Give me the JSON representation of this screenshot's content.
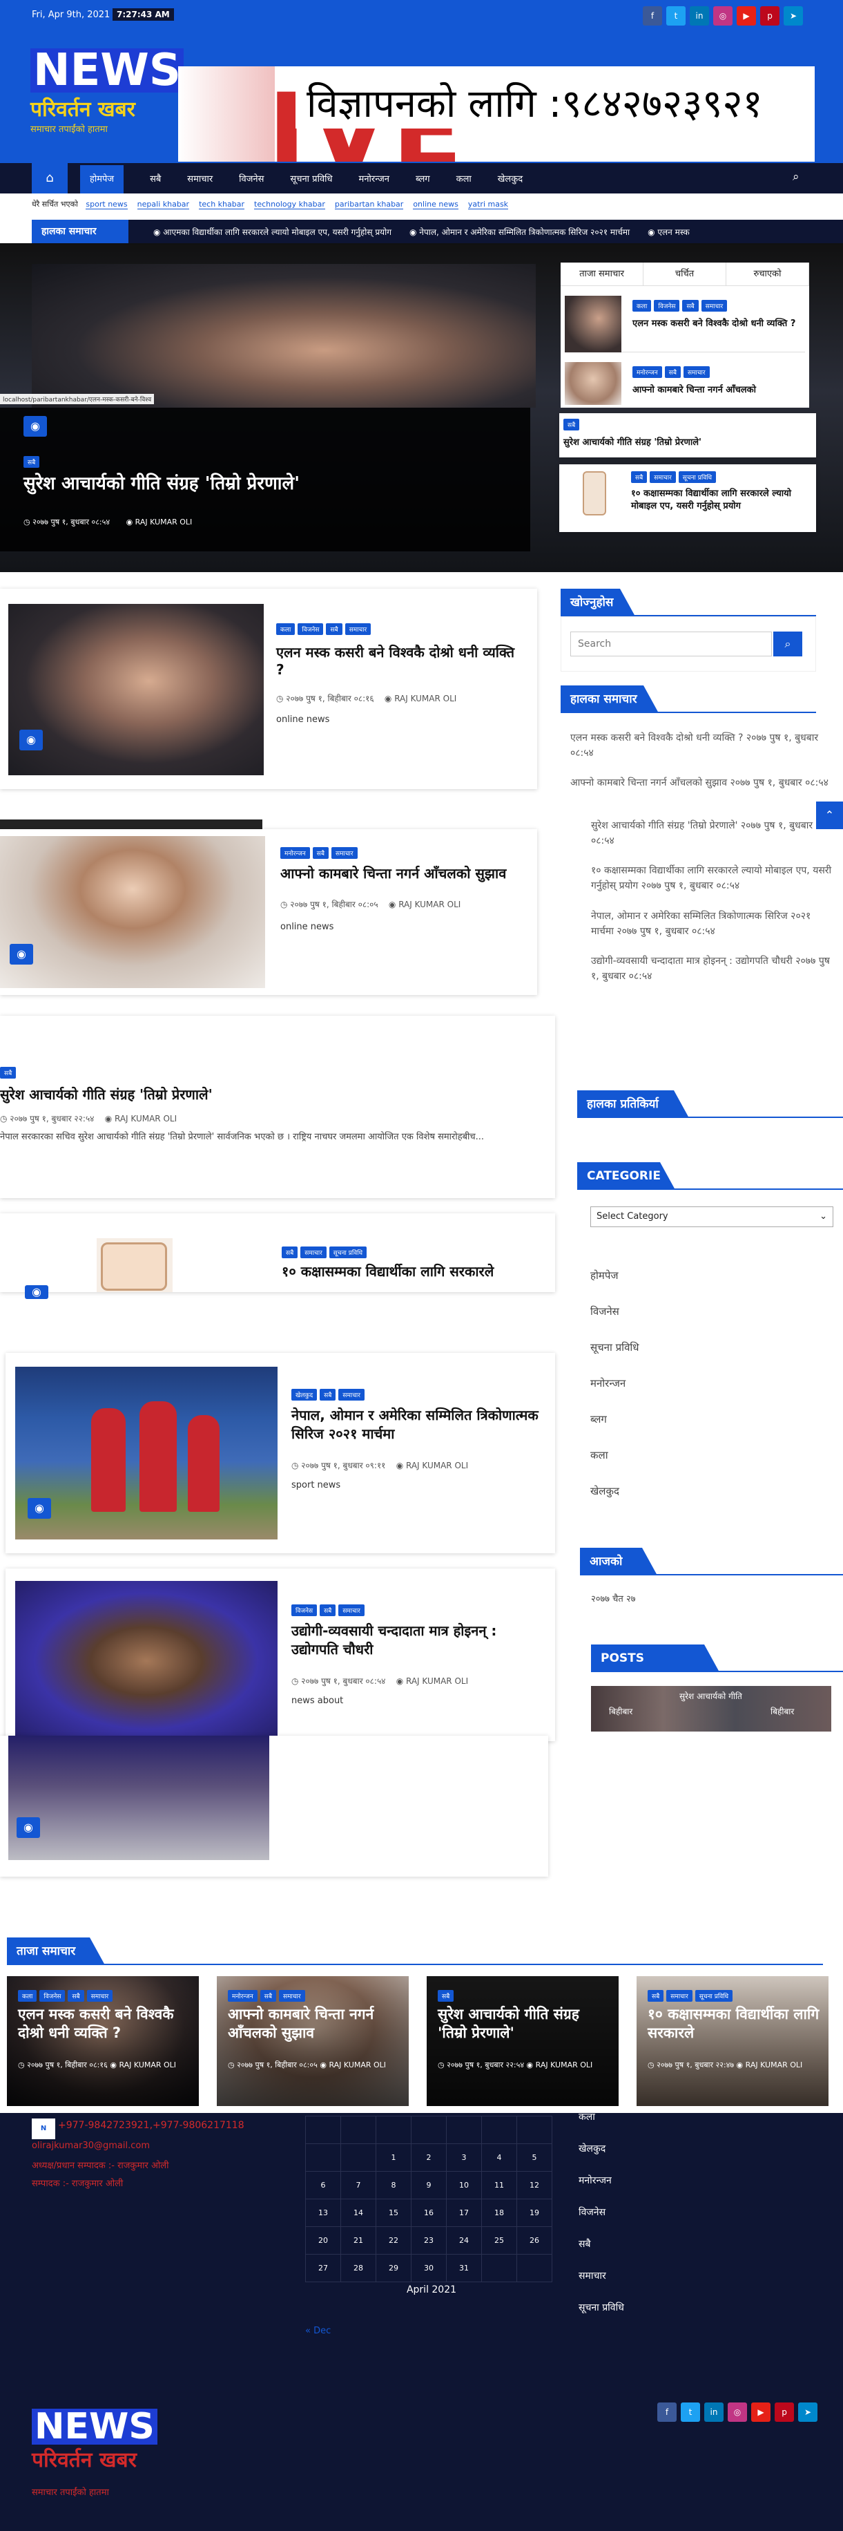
{
  "topbar": {
    "date": "Fri, Apr 9th, 2021",
    "time": "7:27:43 AM"
  },
  "logo": {
    "main": "NEWS",
    "sub": "परिवर्तन खबर",
    "tag": "समाचार तपाईंको हातमा"
  },
  "ad": {
    "text": "विज्ञापनको लागि :९८४२७२३९२१",
    "bg_text": "LIVE NEWS"
  },
  "nav": {
    "items": [
      "होमपेज",
      "सबै",
      "समाचार",
      "विजनेस",
      "सूचना प्रविधि",
      "मनोरन्जन",
      "ब्लग",
      "कला",
      "खेलकुद"
    ]
  },
  "tags": {
    "label": "धेरै सर्चित भएको",
    "items": [
      "sport news",
      "nepali khabar",
      "tech khabar",
      "technology khabar",
      "paribartan khabar",
      "online news",
      "yatri mask"
    ]
  },
  "ticker": {
    "label": "हालका समाचार",
    "items": [
      "आएमका विद्यार्थीका लागि सरकारले ल्यायो मोबाइल एप, यसरी गर्नुहोस् प्रयोग",
      "नेपाल, ओमान र अमेरिका सम्मिलित त्रिकोणात्मक सिरिज २०२१ मार्चमा",
      "एलन मस्क"
    ]
  },
  "hero": {
    "url": "localhost/paribartankhabar/एलन-मस्क-कसरी-बने-विश्व",
    "badge": "सबै",
    "title": "सुरेश आचार्यको गीति संग्रह 'तिम्रो प्रेरणाले'",
    "date": "२०७७ पुष १, बुधबार ०८:५४",
    "author": "RAJ KUMAR OLI"
  },
  "tabs": {
    "items": [
      "ताजा समाचार",
      "चर्चित",
      "रुचाएको"
    ]
  },
  "tabposts": [
    {
      "badges": [
        "कला",
        "विजनेस",
        "सबै",
        "समाचार"
      ],
      "title": "एलन मस्क कसरी बने विश्वकै दोश्रो धनी व्यक्ति ?"
    },
    {
      "badges": [
        "मनोरन्जन",
        "सबै",
        "समाचार"
      ],
      "title": "आफ्नो कामबारे चिन्ता नगर्न आँचलको"
    },
    {
      "badges": [
        "सबै"
      ],
      "title": "सुरेश आचार्यको गीति संग्रह 'तिम्रो प्रेरणाले'"
    },
    {
      "badges": [
        "सबै",
        "समाचार",
        "सूचना प्रविधि"
      ],
      "title": "१० कक्षासम्मका विद्यार्थीका लागि सरकारले ल्यायो मोबाइल एप, यसरी गर्नुहोस् प्रयोग"
    }
  ],
  "posts": [
    {
      "badges": [
        "कला",
        "विजनेस",
        "सबै",
        "समाचार"
      ],
      "title": "एलन मस्क कसरी बने विश्वकै दोश्रो धनी व्यक्ति ?",
      "date": "२०७७ पुष १, बिहीबार ०८:१६",
      "author": "RAJ KUMAR OLI",
      "tag": "online news"
    },
    {
      "badges": [
        "मनोरन्जन",
        "सबै",
        "समाचार"
      ],
      "title": "आफ्नो कामबारे चिन्ता नगर्न आँचलको सुझाव",
      "date": "२०७७ पुष १, बिहीबार ०८:०५",
      "author": "RAJ KUMAR OLI",
      "tag": "online news"
    },
    {
      "badges": [
        "सबै"
      ],
      "title": "सुरेश आचार्यको गीति संग्रह 'तिम्रो प्रेरणाले'",
      "date": "२०७७ पुष १, बुधबार २२:५४",
      "author": "RAJ KUMAR OLI",
      "excerpt": "नेपाल सरकारका सचिव सुरेश आचार्यको गीति संग्रह 'तिम्रो प्रेरणाले' सार्वजनिक भएको छ । राष्ट्रिय नाचघर जमलमा आयोजित एक विशेष समारोहबीच..."
    },
    {
      "badges": [
        "सबै",
        "समाचार",
        "सूचना प्रविधि"
      ],
      "title": "१० कक्षासम्मका विद्यार्थीका लागि सरकारले"
    },
    {
      "badges": [
        "खेलकुद",
        "सबै",
        "समाचार"
      ],
      "title": "नेपाल, ओमान र अमेरिका सम्मिलित त्रिकोणात्मक सिरिज २०२१ मार्चमा",
      "date": "२०७७ पुष १, बुधबार ०९:११",
      "author": "RAJ KUMAR OLI",
      "tag": "sport news"
    },
    {
      "badges": [
        "विजनेस",
        "सबै",
        "समाचार"
      ],
      "title": "उद्योगी-व्यवसायी चन्दादाता मात्र होइनन् : उद्योगपति चौधरी",
      "date": "२०७७ पुष १, बुधबार ०८:५४",
      "author": "RAJ KUMAR OLI",
      "tag": "news about"
    }
  ],
  "sidebar": {
    "search_title": "खोज्नुहोस",
    "search_placeholder": "Search",
    "recent_title": "हालका समाचार",
    "recent": [
      "एलन मस्क कसरी बने विश्वकै दोश्रो धनी व्यक्ति ? २०७७ पुष १, बुधबार ०८:५४",
      "आफ्नो कामबारे चिन्ता नगर्न आँचलको सुझाव २०७७ पुष १, बुधबार ०८:५४",
      "सुरेश आचार्यको गीति संग्रह 'तिम्रो प्रेरणाले' २०७७ पुष १, बुधबार ०८:५४",
      "१० कक्षासम्मका विद्यार्थीका लागि सरकारले ल्यायो मोबाइल एप, यसरी गर्नुहोस् प्रयोग २०७७ पुष १, बुधबार ०८:५४",
      "नेपाल, ओमान र अमेरिका सम्मिलित त्रिकोणात्मक सिरिज २०२१ मार्चमा २०७७ पुष १, बुधबार ०८:५४",
      "उद्योगी-व्यवसायी चन्दादाता मात्र होइनन् : उद्योगपति चौधरी २०७७ पुष १, बुधबार ०८:५४"
    ],
    "comments_title": "हालका प्रतिकिर्या",
    "categories_title": "CATEGORIES",
    "category_select": "Select Category",
    "categories": [
      "होमपेज",
      "विजनेस",
      "सूचना प्रविधि",
      "मनोरन्जन",
      "ब्लग",
      "कला",
      "खेलकुद"
    ],
    "date_title": "आजको तिथि",
    "date_value": "२०७७ चैत २७",
    "carousel_title": "POSTS CAROUSEL",
    "carousel_items": [
      "बिहीबार",
      "सुरेश आचार्यको गीति",
      "बिहीबार"
    ]
  },
  "trending": {
    "title": "ताजा समाचार",
    "items": [
      {
        "badges": [
          "कला",
          "विजनेस",
          "सबै",
          "समाचार"
        ],
        "title": "एलन मस्क कसरी बने विश्वकै दोश्रो धनी व्यक्ति ?",
        "date": "२०७७ पुष १, बिहीबार ०८:१६",
        "author": "RAJ KUMAR OLI"
      },
      {
        "badges": [
          "मनोरन्जन",
          "सबै",
          "समाचार"
        ],
        "title": "आफ्नो कामबारे चिन्ता नगर्न आँचलको सुझाव",
        "date": "२०७७ पुष १, बिहीबार ०८:०५",
        "author": "RAJ KUMAR OLI"
      },
      {
        "badges": [
          "सबै"
        ],
        "title": "सुरेश आचार्यको गीति संग्रह 'तिम्रो प्रेरणाले'",
        "date": "२०७७ पुष १, बुधबार २२:५४",
        "author": "RAJ KUMAR OLI"
      },
      {
        "badges": [
          "सबै",
          "समाचार",
          "सूचना प्रविधि"
        ],
        "title": "१० कक्षासम्मका विद्यार्थीका लागि सरकारले",
        "date": "२०७७ पुष १, बुधबार २२:४७",
        "author": "RAJ KUMAR OLI"
      }
    ]
  },
  "footer": {
    "phone": "+977-9842723921,+977-9806217118",
    "email": "olirajkumar30@gmail.com",
    "editor1": "अध्यक्ष/प्रधान सम्पादक :- राजकुमार ओली",
    "editor2": "सम्पादक :- राजकुमार ओली",
    "calendar_caption": "April 2021",
    "calendar_prev": "« Dec",
    "calendar_rows": [
      [
        "",
        "",
        "",
        "1",
        "2",
        "3",
        "4",
        "5"
      ],
      [
        "6",
        "7",
        "8",
        "9",
        "10",
        "11",
        "12"
      ],
      [
        "13",
        "14",
        "15",
        "16",
        "17",
        "18",
        "19"
      ],
      [
        "20",
        "21",
        "22",
        "23",
        "24",
        "25",
        "26"
      ],
      [
        "27",
        "28",
        "29",
        "30",
        "31",
        "",
        ""
      ]
    ],
    "links": [
      "कला",
      "खेलकुद",
      "मनोरन्जन",
      "विजनेस",
      "सबै",
      "समाचार",
      "सूचना प्रविधि"
    ],
    "logo_main": "NEWS",
    "logo_sub": "परिवर्तन खबर",
    "logo_tag": "समाचार तपाईंको हातमा"
  },
  "colors": {
    "accent": "#1357d3",
    "navy": "#0e1533",
    "red": "#d32a2a"
  }
}
